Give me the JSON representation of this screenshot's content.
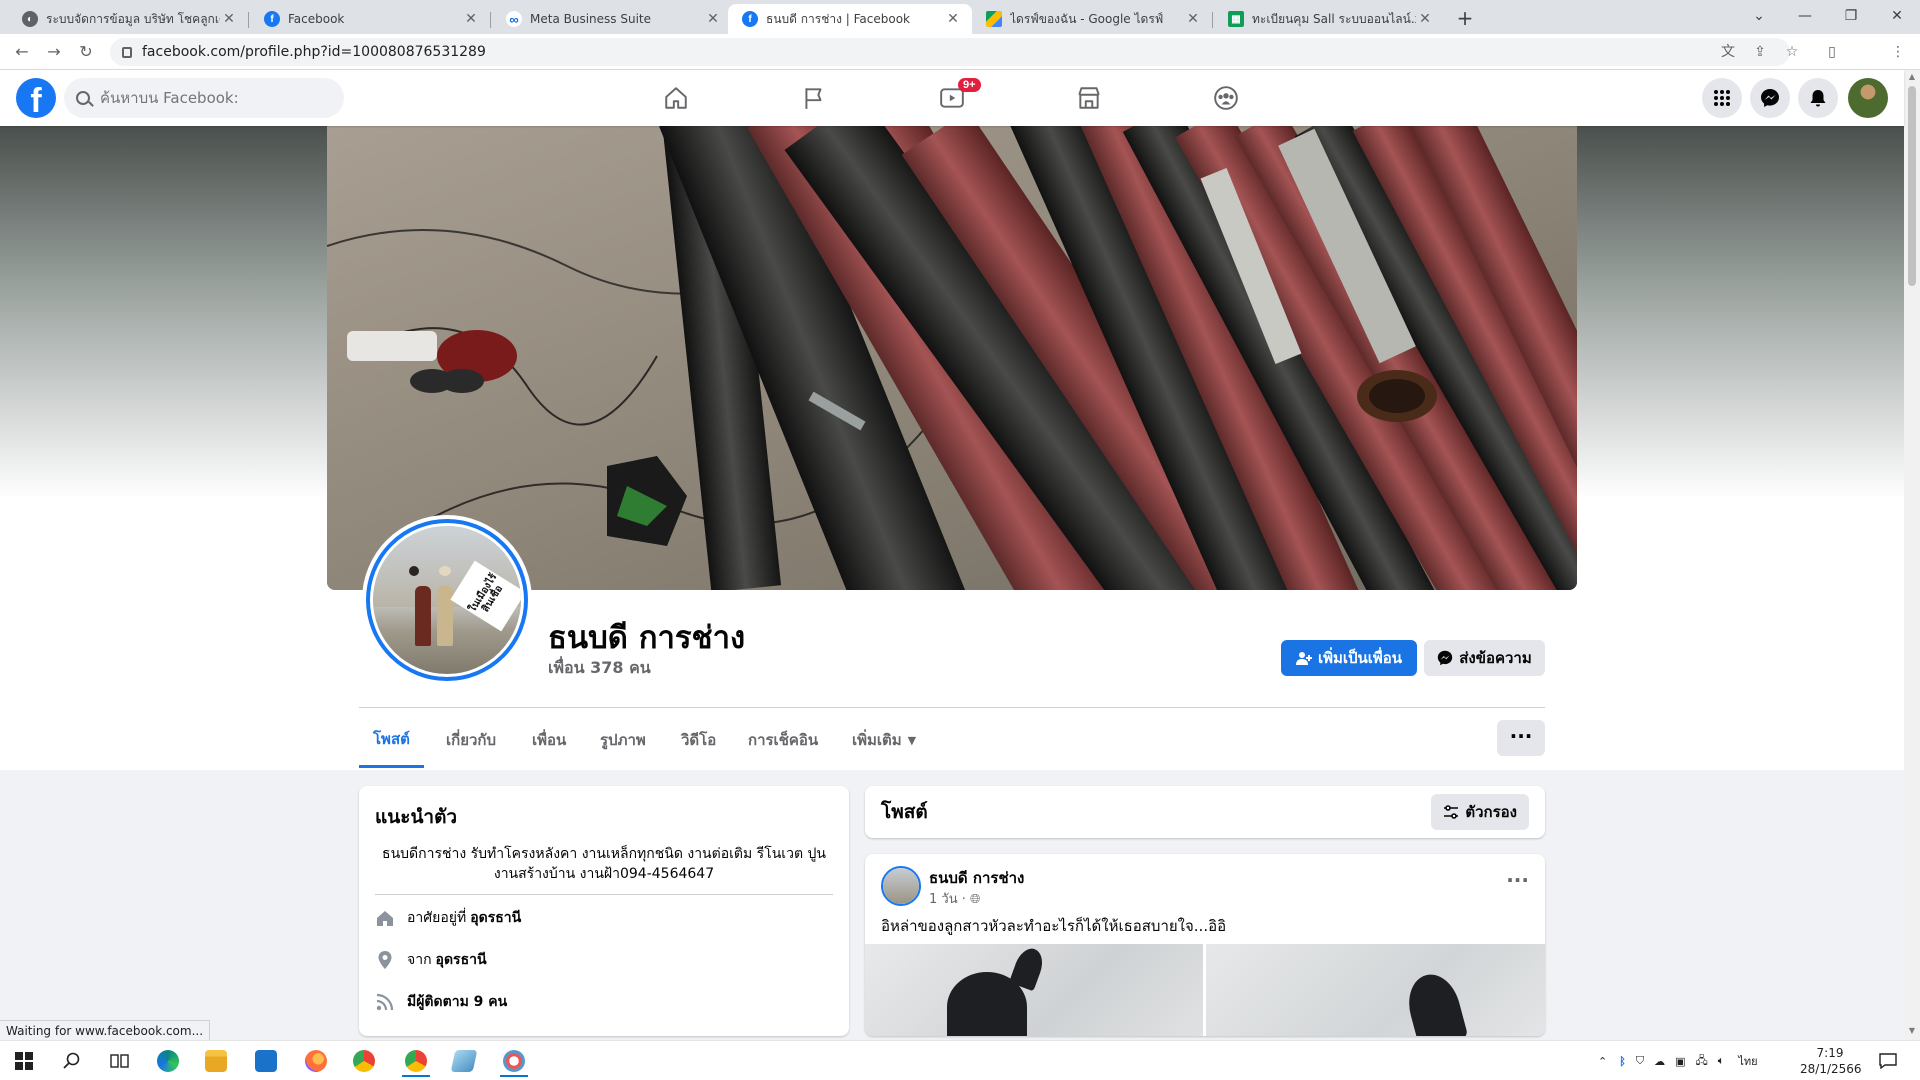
{
  "browser": {
    "tabs": [
      {
        "title": "ระบบจัดการข้อมูล บริษัท โชคลูกเด็ด",
        "favicon": "globe-icon",
        "color": "#5f6368"
      },
      {
        "title": "Facebook",
        "favicon": "facebook-icon",
        "color": "#1877f2"
      },
      {
        "title": "Meta Business Suite",
        "favicon": "meta-icon",
        "color": "#0668e1"
      },
      {
        "title": "ธนบดี การช่าง | Facebook",
        "favicon": "facebook-icon",
        "color": "#1877f2"
      },
      {
        "title": "ไดรฟ์ของฉัน - Google ไดรฟ์",
        "favicon": "google-drive-icon",
        "color": "#fbbc04"
      },
      {
        "title": "ทะเบียนคุม Sall ระบบออนไลน์.xlsx - G",
        "favicon": "google-sheets-icon",
        "color": "#0f9d58"
      }
    ],
    "active_tab": 3,
    "url": "facebook.com/profile.php?id=100080876531289",
    "status_text": "Waiting for www.facebook.com..."
  },
  "fb_header": {
    "search_placeholder": "ค้นหาบน Facebook:",
    "video_badge": "9+",
    "nav_icons": [
      "home-icon",
      "flag-icon",
      "watch-icon",
      "marketplace-icon",
      "groups-icon"
    ],
    "right_icons": [
      "menu-grid-icon",
      "messenger-icon",
      "bell-icon",
      "account-avatar"
    ]
  },
  "profile": {
    "name": "ธนบดี การช่าง",
    "friends": "เพื่อน 378 คน",
    "add_friend": "เพิ่มเป็นเพื่อน",
    "message": "ส่งข้อความ",
    "stamp_text": "ในเมืองไร้สินเชื่อ",
    "tabs": [
      "โพสต์",
      "เกี่ยวกับ",
      "เพื่อน",
      "รูปภาพ",
      "วิดีโอ",
      "การเช็คอิน",
      "เพิ่มเติม"
    ],
    "active_tab": 0
  },
  "intro": {
    "title": "แนะนำตัว",
    "bio": "ธนบดีการช่าง รับทำโครงหลังคา งานเหล็กทุกชนิด งานต่อเติม รีโนเวต ปูน งานสร้างบ้าน งานฝ้า094-4564647",
    "lives_prefix": "อาศัยอยู่ที่",
    "lives_in": "อุดรธานี",
    "from_prefix": "จาก",
    "from": "อุดรธานี",
    "followers": "มีผู้ติดตาม 9 คน"
  },
  "posts": {
    "title": "โพสต์",
    "filter": "ตัวกรอง",
    "first": {
      "author": "ธนบดี การช่าง",
      "time": "1 วัน · ",
      "text": "อิหล่าของลูกสาวหัวละทำอะไรก็ได้ให้เธอสบายใจ...อิอิ"
    }
  },
  "taskbar": {
    "apps": [
      "windows-start-icon",
      "search-icon",
      "task-view-icon",
      "edge-icon",
      "file-explorer-icon",
      "mail-icon",
      "firefox-icon",
      "chrome-icon",
      "chrome-profile-icon",
      "app-icon",
      "paint-icon"
    ],
    "lang": "ไทย",
    "time": "7:19",
    "date": "28/1/2566"
  },
  "colors": {
    "fb_blue": "#1877f2",
    "button_blue": "#1b74e4",
    "surface": "#f0f2f5"
  }
}
